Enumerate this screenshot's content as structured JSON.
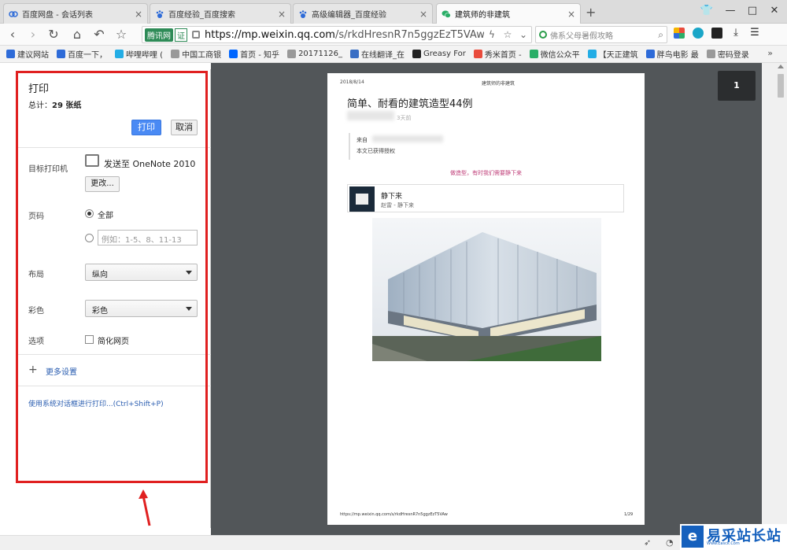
{
  "browser": {
    "tabs": [
      {
        "label": "百度网盘 - 会话列表",
        "icon": "baidu-pan-icon",
        "active": false
      },
      {
        "label": "百度经验_百度搜索",
        "icon": "baidu-paw-icon",
        "active": false
      },
      {
        "label": "高级编辑器_百度经验",
        "icon": "baidu-paw-icon",
        "active": false
      },
      {
        "label": "建筑师的非建筑",
        "icon": "wechat-icon",
        "active": true
      }
    ],
    "address": {
      "security_badge": "腾讯网",
      "cert_badge": "证",
      "url_domain": "https://mp.weixin.qq.com",
      "url_path": "/s/rkdHresnR7n5ggzEzT5VAw"
    },
    "search": {
      "placeholder": "佛系父母暑假攻略"
    },
    "bookmarks": [
      {
        "label": "建议网站",
        "icon": "baidu-icon",
        "color": "#2e6bd8"
      },
      {
        "label": "百度一下，",
        "icon": "baidu-paw-icon",
        "color": "#2e6bd8"
      },
      {
        "label": "哔哩哔哩 (",
        "icon": "bilibili-icon",
        "color": "#23ade5"
      },
      {
        "label": "中国工商银",
        "icon": "page-icon",
        "color": "#999999"
      },
      {
        "label": "首页 - 知乎",
        "icon": "zhihu-icon",
        "color": "#0066ff"
      },
      {
        "label": "20171126_",
        "icon": "page-icon",
        "color": "#999999"
      },
      {
        "label": "在线翻译_在",
        "icon": "translate-icon",
        "color": "#3a6fc4"
      },
      {
        "label": "Greasy For",
        "icon": "greasy-icon",
        "color": "#222222"
      },
      {
        "label": "秀米首页 -",
        "icon": "xiumi-icon",
        "color": "#e94b3c"
      },
      {
        "label": "微信公众平",
        "icon": "wechat-icon",
        "color": "#2aae67"
      },
      {
        "label": "【天正建筑",
        "icon": "bilibili-icon",
        "color": "#23ade5"
      },
      {
        "label": "胖鸟电影 最",
        "icon": "p-icon",
        "color": "#2e6bd8"
      },
      {
        "label": "密码登录",
        "icon": "page-icon",
        "color": "#999999"
      }
    ]
  },
  "print_panel": {
    "title": "打印",
    "total_prefix": "总计：",
    "total_value": "29 张纸",
    "print_button": "打印",
    "cancel_button": "取消",
    "destination_label": "目标打印机",
    "destination_name": "发送至 OneNote 2010",
    "change_button": "更改...",
    "pages_label": "页码",
    "pages_all": "全部",
    "pages_range_placeholder": "例如：1-5、8、11-13",
    "layout_label": "布局",
    "layout_value": "纵向",
    "color_label": "彩色",
    "color_value": "彩色",
    "options_label": "选项",
    "simplify_label": "简化网页",
    "more_settings": "更多设置",
    "system_dialog_link": "使用系统对话框进行打印...(Ctrl+Shift+P)"
  },
  "preview": {
    "page_number": "1",
    "header_date": "2018/8/14",
    "header_title": "建筑师的非建筑",
    "article_title": "简单、耐看的建筑造型44例",
    "time_ago": "3天前",
    "quote_from": "来自",
    "quote_auth": "本文已获得授权",
    "tagline": "做造型，有时我们需要静下来",
    "card_title": "静下来",
    "card_sub": "赵雷 - 静下来",
    "footer_url": "https://mp.weixin.qq.com/s/rkdHresnR7n5ggzEzT5VAw",
    "footer_page": "1/29"
  },
  "watermark": {
    "icon_glyph": "e",
    "text": "易采站长站",
    "sub": "Www.Easck.Com"
  }
}
